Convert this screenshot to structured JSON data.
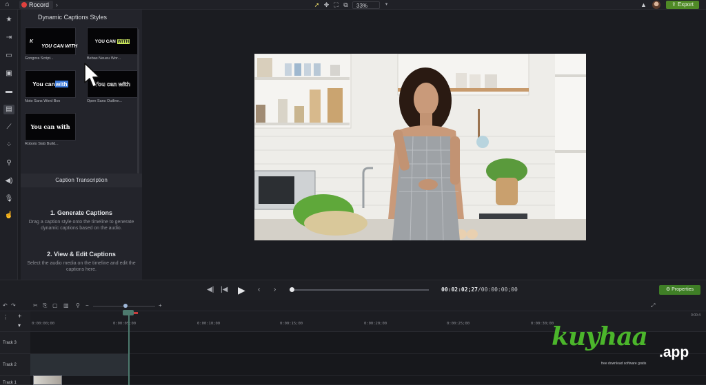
{
  "topbar": {
    "home_icon": "home-icon",
    "record_label": "Rocord",
    "zoom_value": "33%",
    "export_label": "Export"
  },
  "left_toolbar": {
    "icons": [
      "star-icon",
      "transitions-icon",
      "annotations-icon",
      "behaviors-icon",
      "cursor-effects-icon",
      "captions-icon",
      "magic-wand-icon",
      "visual-effects-icon",
      "zoom-icon",
      "audio-icon",
      "mic-icon",
      "interactivity-icon"
    ],
    "active_index": 5
  },
  "captions_panel": {
    "title": "Dynamic Captions Styles",
    "styles": [
      {
        "caption": "Gongora Script...",
        "sample_a": "K",
        "sample_b": "YOU CAN WITH"
      },
      {
        "caption": "Bebas Neueu Wor...",
        "sample_a": "YOU CAN",
        "sample_b": "WITH"
      },
      {
        "caption": "Noto Sans Word Box",
        "sample_a": "You can ",
        "sample_b": "with"
      },
      {
        "caption": "Open Sans Outline...",
        "sample_a": "You can with"
      },
      {
        "caption": "Roboto Slab Build...",
        "sample_a": "You can with"
      }
    ],
    "transcription_title": "Caption Transcription",
    "step1_title": "1. Generate Captions",
    "step1_body": "Drag a caption style onto the timeline to generate dynamic captions based on the audio.",
    "step2_title": "2. View & Edit Captions",
    "step2_body": "Select the audio media on the timeline and edit the captions here."
  },
  "transport": {
    "time_current": "00:02:02;27",
    "time_total": "/00:00:00;00",
    "properties_label": "Properties"
  },
  "timeline": {
    "ticks": [
      "0:00:00;00",
      "0:00:05;00",
      "0:00:10;00",
      "0:00:15;00",
      "0:00:20;00",
      "0:00:25;00",
      "0:00:30;00"
    ],
    "ruler_end": "0:00:4",
    "tracks": [
      "Track 3",
      "Track 2",
      "Track 1"
    ]
  },
  "watermark": {
    "brand": "kuyhaa",
    "suffix": ".app",
    "tagline": "free download software gratis"
  },
  "colors": {
    "accent_green": "#4f8a26",
    "caption_highlight_blue": "#3a78d8",
    "caption_highlight_lime": "#c9e55a",
    "record_red": "#e0413e"
  }
}
